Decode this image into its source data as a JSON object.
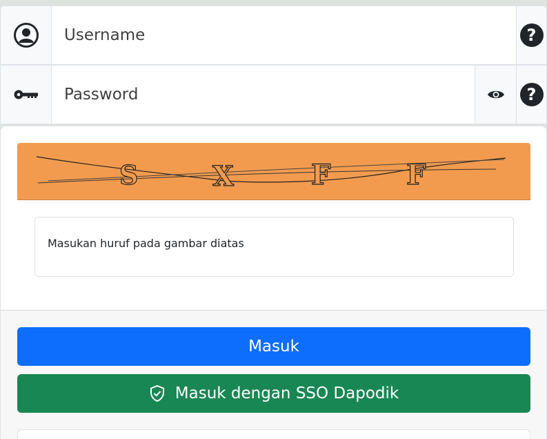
{
  "login": {
    "username_placeholder": "Username",
    "password_placeholder": "Password"
  },
  "icons": {
    "user": "user-circle-icon",
    "key": "key-icon",
    "eye": "eye-icon",
    "help": "question-circle-icon",
    "shield": "shield-check-icon"
  },
  "help": {
    "symbol": "?"
  },
  "captcha": {
    "letters": [
      "S",
      "X",
      "F",
      "F"
    ],
    "input_placeholder": "Masukan huruf pada gambar diatas",
    "bg_color": "#f29b4e"
  },
  "buttons": {
    "login_label": "Masuk",
    "sso_label": "Masuk dengan SSO Dapodik",
    "primary_color": "#0d6efd",
    "success_color": "#198754"
  }
}
